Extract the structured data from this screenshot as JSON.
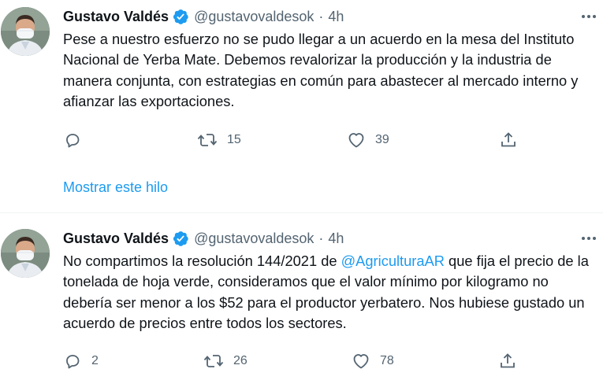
{
  "tweets": [
    {
      "author_name": "Gustavo Valdés",
      "handle": "@gustavovaldesok",
      "separator": "·",
      "time": "4h",
      "text": "Pese a nuestro esfuerzo no se pudo llegar a un acuerdo en la mesa del Instituto Nacional de Yerba Mate. Debemos revalorizar la producción y la industria de manera conjunta, con estrategias en común para abastecer al mercado interno y afianzar las exportaciones.",
      "replies": "",
      "retweets": "15",
      "likes": "39",
      "show_thread": "Mostrar este hilo"
    },
    {
      "author_name": "Gustavo Valdés",
      "handle": "@gustavovaldesok",
      "separator": "·",
      "time": "4h",
      "text_before": "No compartimos la resolución 144/2021 de ",
      "mention": "@AgriculturaAR",
      "text_after": " que fija el precio de la tonelada de hoja verde, consideramos que el valor mínimo por kilogramo no debería ser menor a los $52 para el productor yerbatero. Nos hubiese gustado un acuerdo de precios entre todos los sectores.",
      "replies": "2",
      "retweets": "26",
      "likes": "78"
    }
  ],
  "icons": {
    "verified": "verified-badge-icon",
    "more": "more-options-icon",
    "reply": "reply-icon",
    "retweet": "retweet-icon",
    "like": "like-icon",
    "share": "share-icon"
  },
  "colors": {
    "accent": "#1d9bf0",
    "text": "#0f1419",
    "secondary": "#536471"
  }
}
